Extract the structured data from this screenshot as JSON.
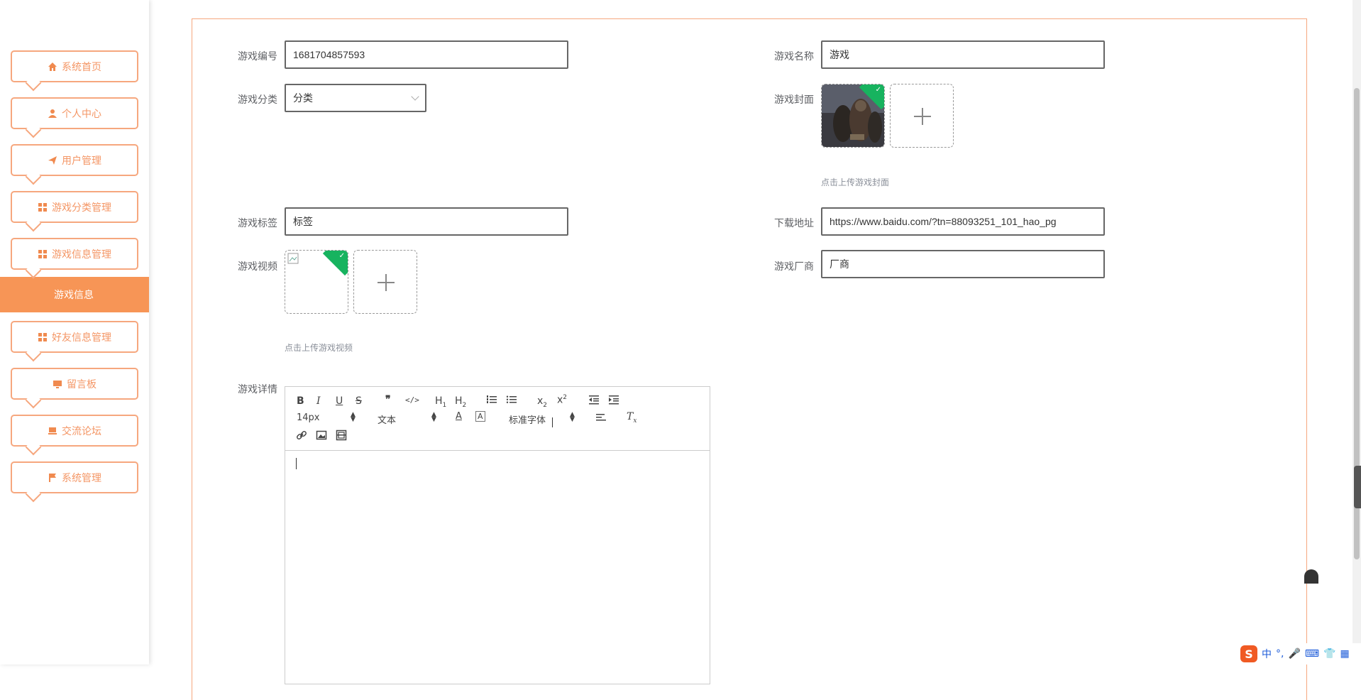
{
  "sidebar": {
    "items": [
      {
        "label": "系统首页",
        "icon": "home-icon"
      },
      {
        "label": "个人中心",
        "icon": "user-icon"
      },
      {
        "label": "用户管理",
        "icon": "send-icon"
      },
      {
        "label": "游戏分类管理",
        "icon": "grid-icon"
      },
      {
        "label": "游戏信息管理",
        "icon": "grid-icon"
      },
      {
        "label": "好友信息管理",
        "icon": "grid-icon"
      },
      {
        "label": "留言板",
        "icon": "monitor-icon"
      },
      {
        "label": "交流论坛",
        "icon": "chat-icon"
      },
      {
        "label": "系统管理",
        "icon": "flag-icon"
      }
    ],
    "active_sub": "游戏信息"
  },
  "form": {
    "game_id": {
      "label": "游戏编号",
      "value": "1681704857593"
    },
    "game_name": {
      "label": "游戏名称",
      "value": "游戏"
    },
    "category": {
      "label": "游戏分类",
      "value": "分类"
    },
    "cover": {
      "label": "游戏封面",
      "hint": "点击上传游戏封面"
    },
    "tags": {
      "label": "游戏标签",
      "value": "标签"
    },
    "download": {
      "label": "下载地址",
      "value": "https://www.baidu.com/?tn=88093251_101_hao_pg"
    },
    "video": {
      "label": "游戏视频",
      "hint": "点击上传游戏视频"
    },
    "vendor": {
      "label": "游戏厂商",
      "value": "厂商"
    },
    "detail": {
      "label": "游戏详情"
    }
  },
  "editor": {
    "font_size": "14px",
    "header_type": "文本",
    "font_family": "标准字体"
  },
  "ime": {
    "lang": "中",
    "punct": "°,"
  },
  "colors": {
    "accent": "#f79556",
    "accent_border": "#f6a77e",
    "success_corner": "#17b35f"
  }
}
